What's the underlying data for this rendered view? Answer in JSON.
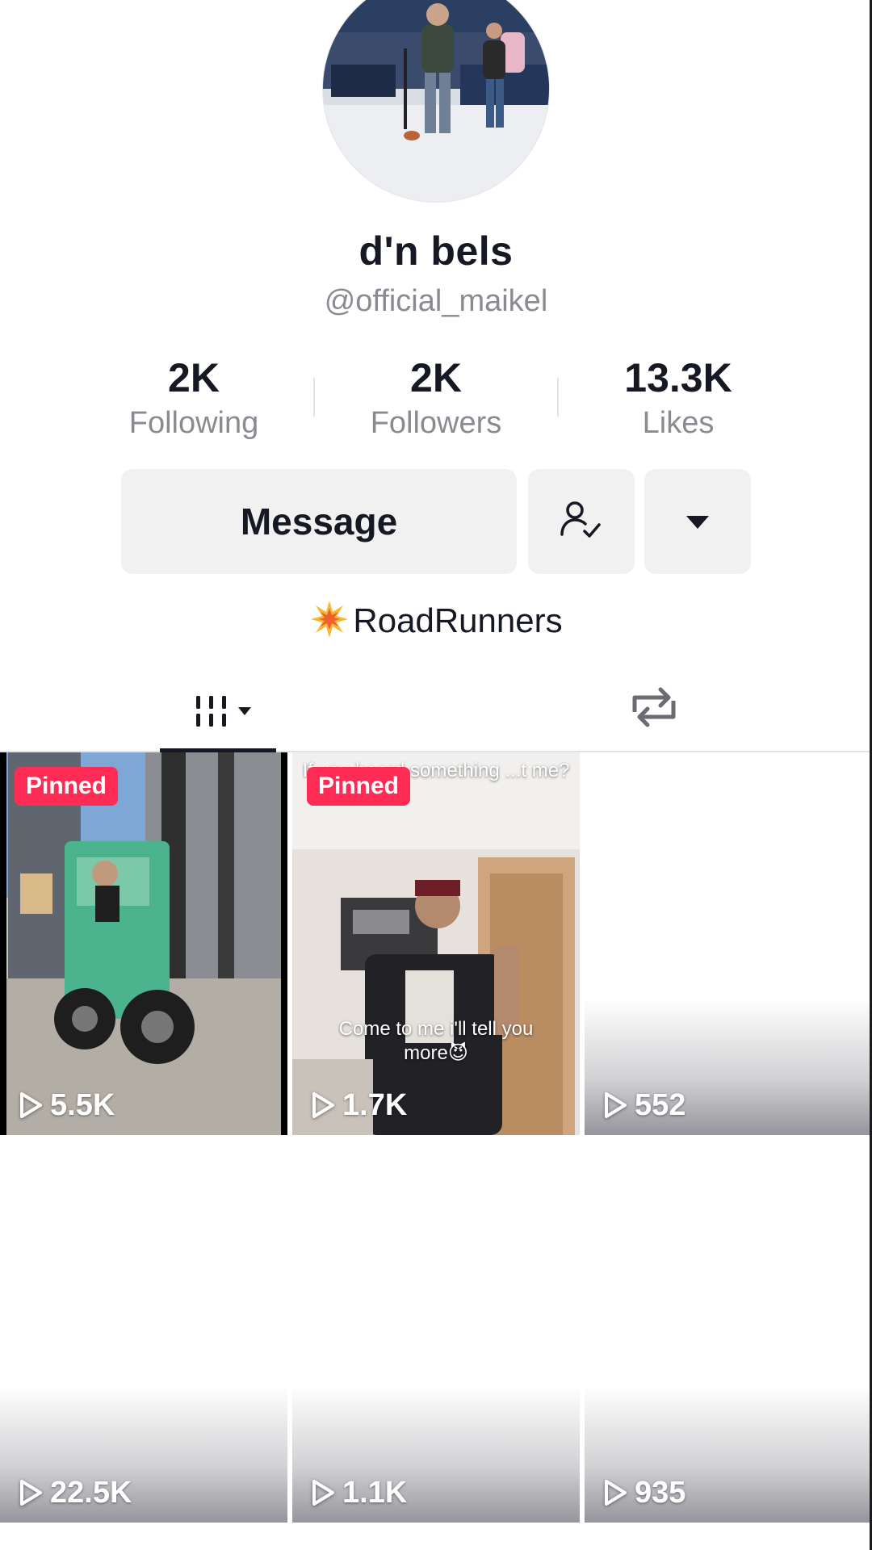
{
  "profile": {
    "display_name": "d'n bels",
    "username": "@official_maikel",
    "bio_emoji": "collision-emoji",
    "bio_text": "RoadRunners"
  },
  "stats": {
    "following": {
      "value": "2K",
      "label": "Following"
    },
    "followers": {
      "value": "2K",
      "label": "Followers"
    },
    "likes": {
      "value": "13.3K",
      "label": "Likes"
    }
  },
  "actions": {
    "message_label": "Message",
    "friend_icon": "friends-check-icon",
    "more_icon": "caret-down-icon"
  },
  "tabs": {
    "videos_icon": "videos-grid-icon",
    "reposts_icon": "repost-icon",
    "active": "videos"
  },
  "videos": [
    {
      "views": "5.5K",
      "pinned": true,
      "pinned_label": "Pinned",
      "thumb": "forklift"
    },
    {
      "views": "1.7K",
      "pinned": true,
      "pinned_label": "Pinned",
      "thumb": "room",
      "caption_top": "If you heard something ...t me?",
      "caption_mid_1": "Come to me i'll tell you",
      "caption_mid_2": "more😈"
    },
    {
      "views": "552",
      "pinned": false,
      "thumb": "blank"
    },
    {
      "views": "22.5K",
      "pinned": false,
      "thumb": "blank"
    },
    {
      "views": "1.1K",
      "pinned": false,
      "thumb": "blank"
    },
    {
      "views": "935",
      "pinned": false,
      "thumb": "blank"
    }
  ],
  "colors": {
    "accent": "#fe2c55",
    "text": "#161823",
    "muted": "#8a8b91",
    "button_bg": "#f1f1f2"
  }
}
